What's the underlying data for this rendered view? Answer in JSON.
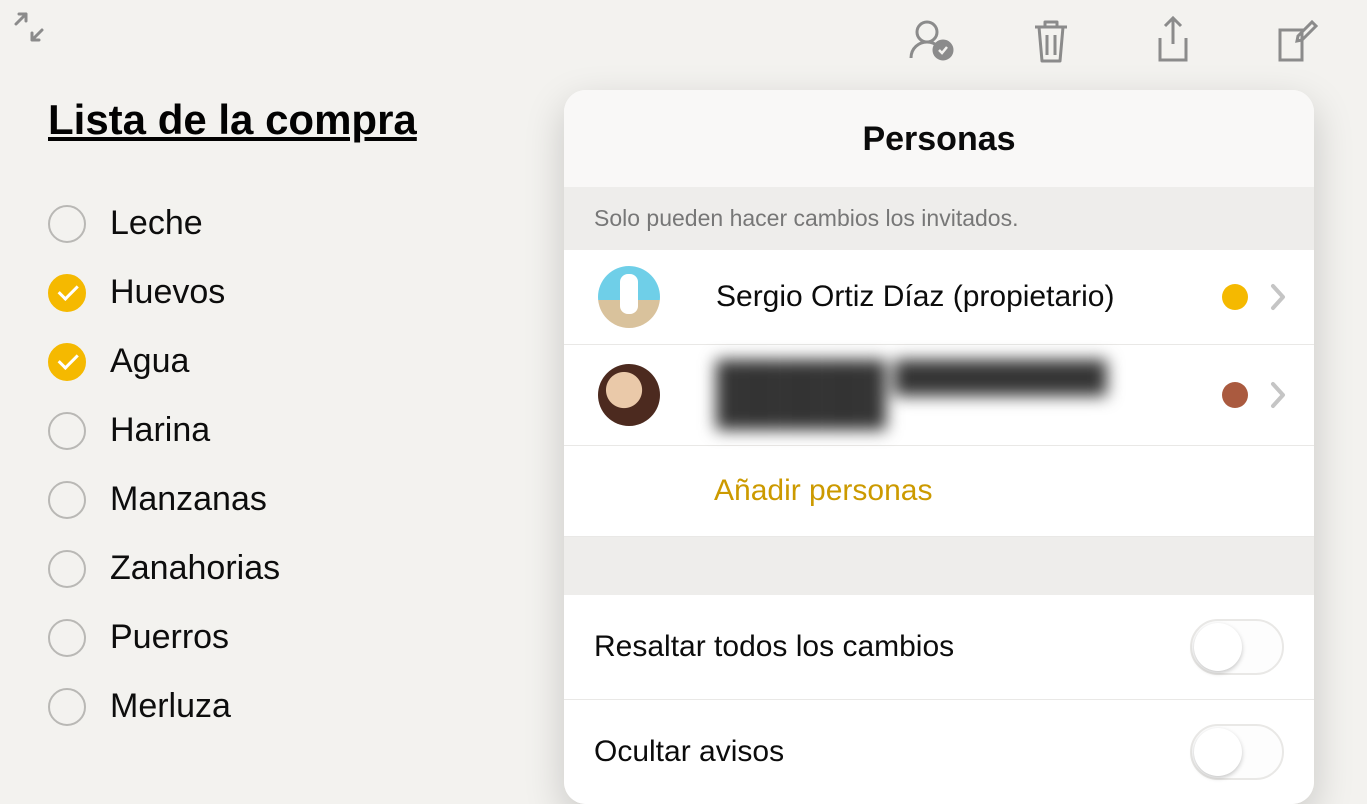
{
  "note": {
    "title": "Lista de la compra",
    "items": [
      {
        "label": "Leche",
        "checked": false
      },
      {
        "label": "Huevos",
        "checked": true
      },
      {
        "label": "Agua",
        "checked": true
      },
      {
        "label": "Harina",
        "checked": false
      },
      {
        "label": "Manzanas",
        "checked": false
      },
      {
        "label": "Zanahorias",
        "checked": false
      },
      {
        "label": "Puerros",
        "checked": false
      },
      {
        "label": "Merluza",
        "checked": false
      }
    ]
  },
  "popover": {
    "title": "Personas",
    "subtitle": "Solo pueden hacer cambios los invitados.",
    "people": [
      {
        "name": "Sergio Ortiz Díaz (propietario)",
        "dot_color": "#f5b900",
        "blurred": false
      },
      {
        "name": "████████ ██████████ ████████",
        "dot_color": "#aa5a3f",
        "blurred": true
      }
    ],
    "add_label": "Añadir personas",
    "settings": [
      {
        "label": "Resaltar todos los cambios",
        "on": false
      },
      {
        "label": "Ocultar avisos",
        "on": false
      }
    ]
  }
}
